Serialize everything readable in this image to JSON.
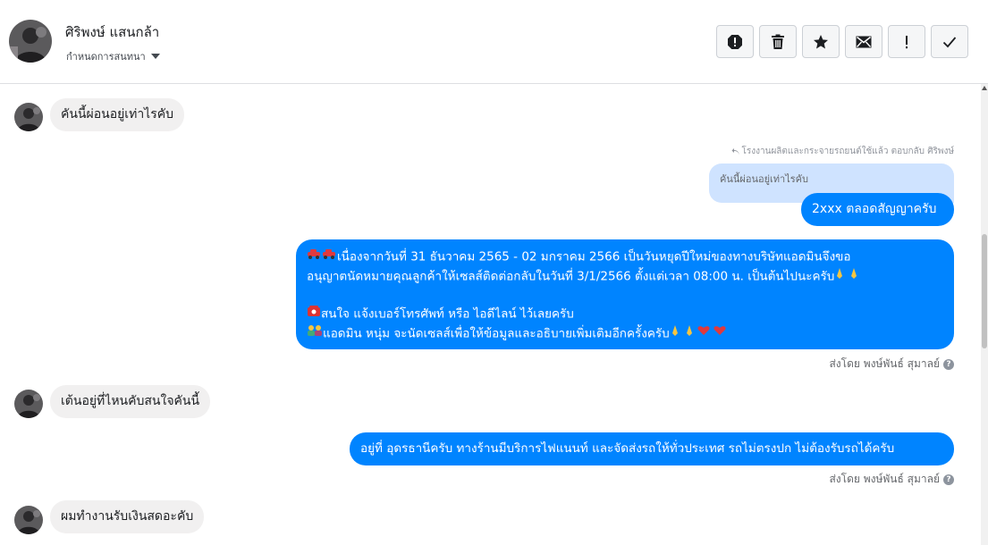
{
  "header": {
    "name": "ศิริพงษ์ แสนกล้า",
    "subtitle": "กำหนดการสนทนา"
  },
  "toolbar": {
    "buttons": [
      {
        "name": "report-icon",
        "label": "Report"
      },
      {
        "name": "trash-icon",
        "label": "Delete"
      },
      {
        "name": "star-icon",
        "label": "Star"
      },
      {
        "name": "mail-icon",
        "label": "Mark unread"
      },
      {
        "name": "important-icon",
        "label": "Important"
      },
      {
        "name": "check-icon",
        "label": "Done"
      }
    ]
  },
  "messages": {
    "m1": {
      "text": "คันนี้ผ่อนอยู่เท่าไรคับ"
    },
    "reply_note": "โรงงานผลิตและกระจายรถยนต์ใช้แล้ว ตอบกลับ ศิริพงษ์",
    "quoted": "คันนี้ผ่อนอยู่เท่าไรคับ",
    "m2": {
      "text": "2xxx ตลอดสัญญาครับ"
    },
    "m3": {
      "line1": "เนื่องจากวันที่ 31 ธันวาคม 2565 - 02 มกราคม 2566 เป็นวันหยุดปีใหม่ของทางบริษัทแอดมินจึงขอ",
      "line2": "อนุญาตนัดหมายคุณลูกค้าให้เซลส์ติดต่อกลับในวันที่  3/1/2566  ตั้งแต่เวลา 08:00 น. เป็นต้นไปนะครับ",
      "line3": "สนใจ แจ้งเบอร์โทรศัพท์ หรือ ไอดีไลน์  ไว้เลยครับ",
      "line4": "แอดมิน หนุ่ม จะนัดเซลส์เพื่อให้ข้อมูลและอธิบายเพิ่มเติมอีกครั้งครับ"
    },
    "sent_by_1": "ส่งโดย พงษ์พันธ์ สุมาลย์",
    "m4": {
      "text": "เต้นอยู่ที่ไหนคับสนใจคันนี้"
    },
    "m5": {
      "text": "อยู่ที่ อุดรธานีครับ ทางร้านมีบริการไฟแนนท์ และจัดส่งรถให้ทั่วประเทศ รถไม่ตรงปก ไม่ต้องรับรถได้ครับ"
    },
    "sent_by_2": "ส่งโดย พงษ์พันธ์ สุมาลย์",
    "m6": {
      "text": "ผมทำงานรับเงินสดอะคับ"
    }
  },
  "colors": {
    "outgoing_bubble": "#0084ff",
    "incoming_bubble": "#f1f0f0",
    "quoted_bubble": "#cfe3ff"
  }
}
